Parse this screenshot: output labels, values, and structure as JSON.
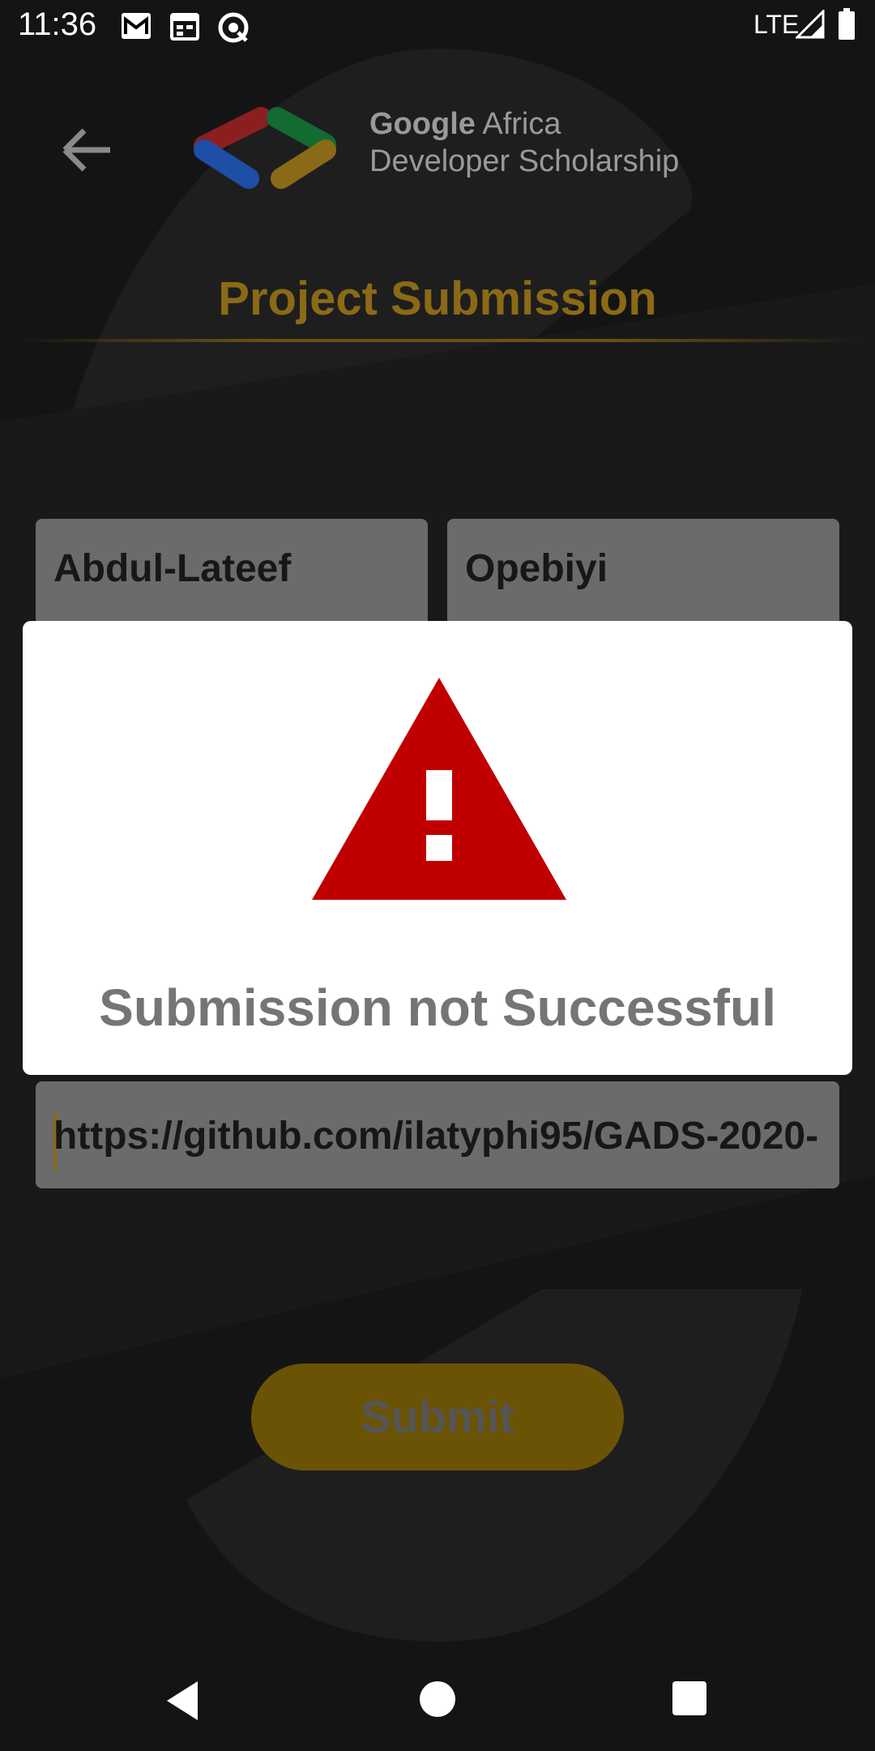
{
  "status_bar": {
    "time": "11:36",
    "network": "LTE",
    "icons": [
      "gmail-icon",
      "calendar-icon",
      "sync-icon",
      "signal-icon",
      "battery-icon"
    ]
  },
  "header": {
    "brand_line1_bold": "Google",
    "brand_line1_rest": "Africa",
    "brand_line2": "Developer Scholarship",
    "back_icon": "arrow-left-icon"
  },
  "page": {
    "title": "Project Submission"
  },
  "form": {
    "first_name": "Abdul-Lateef",
    "last_name": "Opebiyi",
    "project_link": "https://github.com/ilatyphi95/GADS-2020-",
    "submit_label": "Submit"
  },
  "dialog": {
    "icon": "warning-icon",
    "message": "Submission not Successful"
  },
  "nav": {
    "back_icon": "nav-back-icon",
    "home_icon": "nav-home-icon",
    "recents_icon": "nav-recents-icon"
  },
  "colors": {
    "accent": "#8a6a16",
    "warning_red": "#c00000"
  }
}
